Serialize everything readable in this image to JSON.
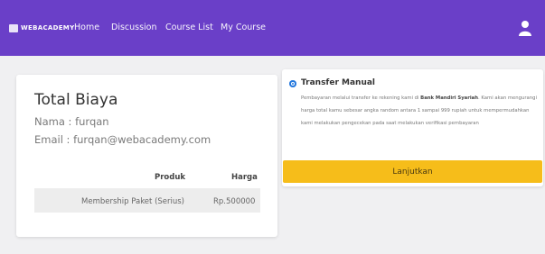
{
  "navbar": {
    "brand": "WEBACADEMY",
    "links": [
      "Home",
      "Discussion",
      "Course List",
      "My Course"
    ]
  },
  "summary": {
    "title": "Total Biaya",
    "name_line": "Nama : furqan",
    "email_line": "Email : furqan@webacademy.com",
    "table": {
      "headers": [
        "Produk",
        "Harga"
      ],
      "rows": [
        {
          "produk": "Membership Paket (Serius)",
          "harga": "Rp.500000"
        }
      ]
    }
  },
  "payment": {
    "method_label": "Transfer Manual",
    "desc_before": "Pembayaran melalui transfer ke rekening kami di ",
    "bank": "Bank Mandiri Syariah",
    "desc_after": ". Kami akan mengurangi harga total kamu sebesar angka random antara 1 sampai 999 rupiah untuk mempermudahkan kami melakukan pengecekan pada saat melakukan verifikasi pembayaran",
    "button_label": "Lanjutkan"
  },
  "colors": {
    "navbar": "#6a3fc8",
    "button": "#f6bd1a",
    "radio": "#2277dd"
  }
}
